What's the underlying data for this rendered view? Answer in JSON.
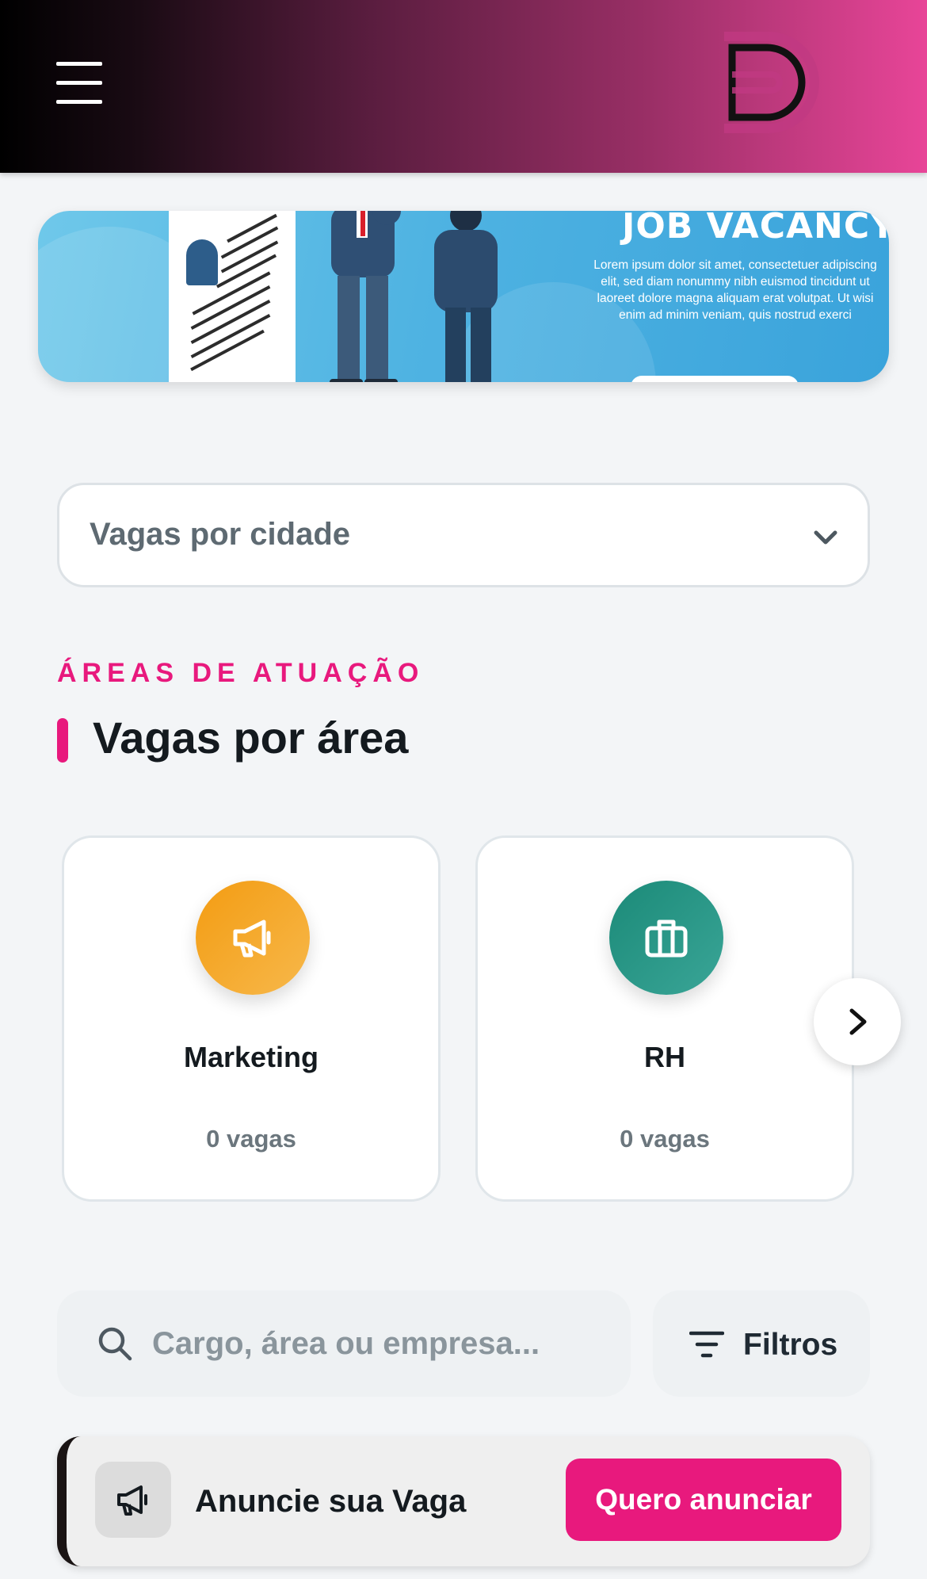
{
  "header": {
    "menu_icon": "hamburger-menu-icon",
    "logo_icon": "brand-d-logo-icon"
  },
  "banner": {
    "heading": "JOB VACANCY",
    "body": "Lorem ipsum dolor sit amet, consectetuer adipiscing elit, sed diam nonummy nibh euismod tincidunt ut laoreet dolore magna aliquam erat volutpat. Ut wisi enim ad minim veniam, quis nostrud exerci"
  },
  "city_select": {
    "selected": "Vagas por cidade",
    "icon": "chevron-down-icon"
  },
  "areas": {
    "eyebrow": "ÁREAS DE ATUAÇÃO",
    "title": "Vagas por área",
    "cards": [
      {
        "name": "Marketing",
        "count": "0 vagas",
        "icon": "megaphone-icon",
        "color": "#f5a21f"
      },
      {
        "name": "RH",
        "count": "0 vagas",
        "icon": "briefcase-icon",
        "color": "#23907f"
      }
    ],
    "next_icon": "chevron-right-icon"
  },
  "search": {
    "placeholder": "Cargo, área ou empresa...",
    "icon": "search-icon",
    "filters_label": "Filtros",
    "filters_icon": "filter-icon"
  },
  "announce": {
    "label": "Anuncie sua Vaga",
    "button": "Quero anunciar",
    "icon": "megaphone-icon"
  },
  "colors": {
    "accent": "#e8197d",
    "background": "#f3f5f7"
  }
}
